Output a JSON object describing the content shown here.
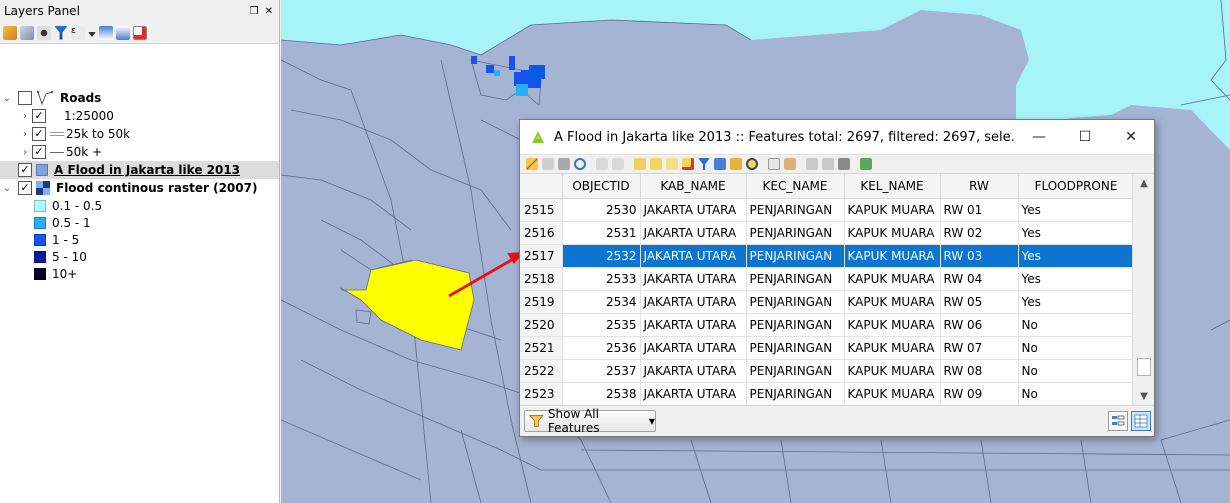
{
  "layers_panel": {
    "title": "Layers Panel",
    "float_icon": "❐",
    "close_icon": "✕",
    "tree": [
      {
        "label": "Roads",
        "checked": false,
        "expanded": true,
        "bold": true
      },
      {
        "label": "1:25000",
        "checked": true
      },
      {
        "label": "25k to 50k",
        "checked": true
      },
      {
        "label": "50k +",
        "checked": true
      },
      {
        "label": "A Flood in Jakarta like 2013",
        "checked": true,
        "selected": true
      },
      {
        "label": "Flood continous raster (2007)",
        "checked": true,
        "expanded": true
      },
      {
        "label": "0.1 - 0.5",
        "color": "#a8ffff"
      },
      {
        "label": "0.5 - 1",
        "color": "#26aef7"
      },
      {
        "label": "1 - 5",
        "color": "#1454ec"
      },
      {
        "label": "5 - 10",
        "color": "#0a1a9a"
      },
      {
        "label": "10+",
        "color": "#06062b"
      }
    ]
  },
  "attribute_table": {
    "title": "A Flood in Jakarta like 2013 :: Features total: 2697, filtered: 2697, sele...",
    "minimize": "—",
    "maximize": "☐",
    "close": "✕",
    "columns": [
      "OBJECTID",
      "KAB_NAME",
      "KEC_NAME",
      "KEL_NAME",
      "RW",
      "FLOODPRONE"
    ],
    "rows": [
      {
        "row": "2515",
        "cells": [
          "2530",
          "JAKARTA UTARA",
          "PENJARINGAN",
          "KAPUK MUARA",
          "RW 01",
          "Yes"
        ]
      },
      {
        "row": "2516",
        "cells": [
          "2531",
          "JAKARTA UTARA",
          "PENJARINGAN",
          "KAPUK MUARA",
          "RW 02",
          "Yes"
        ]
      },
      {
        "row": "2517",
        "cells": [
          "2532",
          "JAKARTA UTARA",
          "PENJARINGAN",
          "KAPUK MUARA",
          "RW 03",
          "Yes"
        ],
        "selected": true
      },
      {
        "row": "2518",
        "cells": [
          "2533",
          "JAKARTA UTARA",
          "PENJARINGAN",
          "KAPUK MUARA",
          "RW 04",
          "Yes"
        ]
      },
      {
        "row": "2519",
        "cells": [
          "2534",
          "JAKARTA UTARA",
          "PENJARINGAN",
          "KAPUK MUARA",
          "RW 05",
          "Yes"
        ]
      },
      {
        "row": "2520",
        "cells": [
          "2535",
          "JAKARTA UTARA",
          "PENJARINGAN",
          "KAPUK MUARA",
          "RW 06",
          "No"
        ]
      },
      {
        "row": "2521",
        "cells": [
          "2536",
          "JAKARTA UTARA",
          "PENJARINGAN",
          "KAPUK MUARA",
          "RW 07",
          "No"
        ]
      },
      {
        "row": "2522",
        "cells": [
          "2537",
          "JAKARTA UTARA",
          "PENJARINGAN",
          "KAPUK MUARA",
          "RW 08",
          "No"
        ]
      },
      {
        "row": "2523",
        "cells": [
          "2538",
          "JAKARTA UTARA",
          "PENJARINGAN",
          "KAPUK MUARA",
          "RW 09",
          "No"
        ]
      }
    ],
    "footer": {
      "show_all_label": "Show All Features"
    }
  },
  "map": {
    "colors": {
      "sea": "#a6f4f8",
      "land": "#a6b4d4",
      "highlight": "#ffff00",
      "boundary": "#5a6a8a",
      "arrow": "#e8141a"
    }
  }
}
